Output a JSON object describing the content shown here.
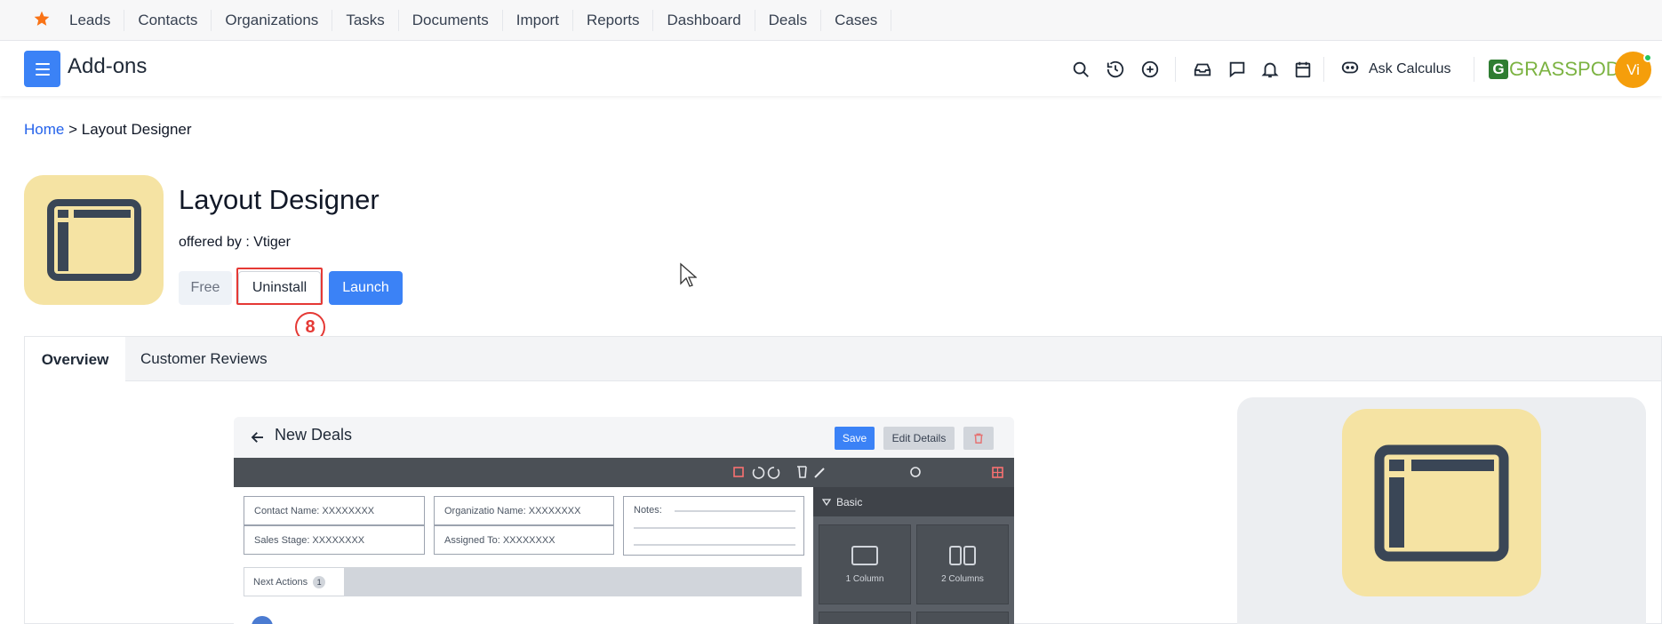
{
  "topnav": {
    "items": [
      "Leads",
      "Contacts",
      "Organizations",
      "Tasks",
      "Documents",
      "Import",
      "Reports",
      "Dashboard",
      "Deals",
      "Cases"
    ]
  },
  "header": {
    "title": "Add-ons",
    "ask_label": "Ask Calculus",
    "brand": "GRASSPODS",
    "avatar_initials": "Vi"
  },
  "breadcrumb": {
    "home": "Home",
    "separator": " > ",
    "current": "Layout Designer"
  },
  "addon": {
    "title": "Layout Designer",
    "offered_by": "offered by : Vtiger",
    "price_label": "Free",
    "uninstall_label": "Uninstall",
    "launch_label": "Launch",
    "step_number": "8"
  },
  "tabs": [
    {
      "label": "Overview",
      "active": true
    },
    {
      "label": "Customer Reviews",
      "active": false
    }
  ],
  "preview": {
    "title": "New Deals",
    "save_label": "Save",
    "edit_label": "Edit Details",
    "fields": {
      "contact": "Contact Name: XXXXXXXX",
      "organization": "Organizatio Name: XXXXXXXX",
      "sales_stage": "Sales Stage: XXXXXXXX",
      "assigned": "Assigned To: XXXXXXXX",
      "notes": "Notes:"
    },
    "next_actions_label": "Next Actions",
    "next_actions_count": "1",
    "side_heading": "Basic",
    "layout_one": "1 Column",
    "layout_two": "2 Columns"
  },
  "colors": {
    "accent": "#3b82f6",
    "logo_bg": "#f5e3a3",
    "logo_fg": "#3a4656",
    "highlight": "#e53935",
    "star": "#f97316"
  }
}
